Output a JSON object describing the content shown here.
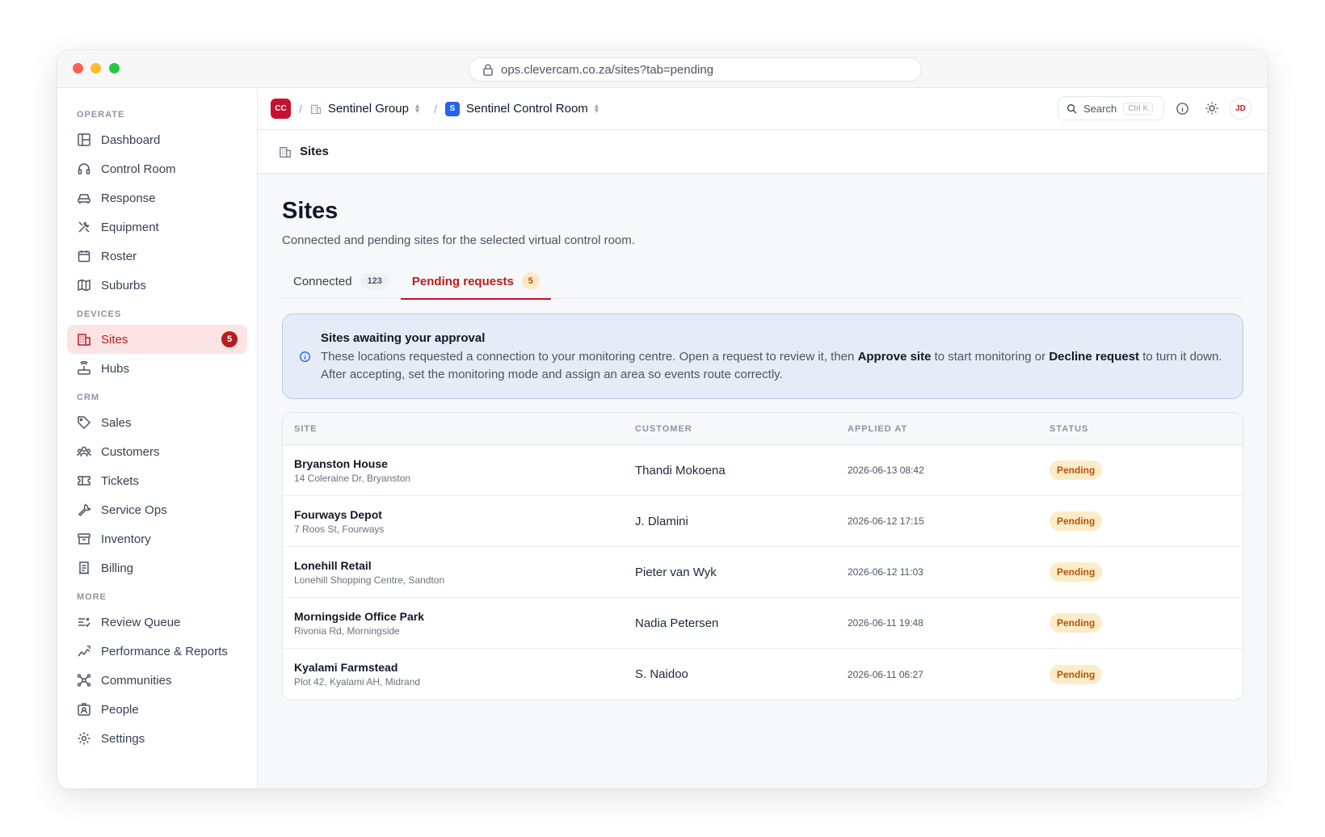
{
  "browser": {
    "url": "ops.clevercam.co.za/sites?tab=pending"
  },
  "topbar": {
    "org_initials": "CC",
    "separator": "/",
    "group_name": "Sentinel Group",
    "room_initial": "S",
    "room_name": "Sentinel Control Room",
    "search_label": "Search",
    "search_shortcut": "Ctrl K",
    "avatar_initials": "JD"
  },
  "sidebar": {
    "sections": [
      {
        "label": "OPERATE"
      },
      {
        "label": "DEVICES"
      },
      {
        "label": "CRM"
      },
      {
        "label": "MORE"
      }
    ],
    "items": [
      {
        "label": "Dashboard",
        "icon": "layout-icon"
      },
      {
        "label": "Control Room",
        "icon": "headset-icon"
      },
      {
        "label": "Response",
        "icon": "car-icon"
      },
      {
        "label": "Equipment",
        "icon": "tools-icon"
      },
      {
        "label": "Roster",
        "icon": "calendar-icon"
      },
      {
        "label": "Suburbs",
        "icon": "map-icon"
      },
      {
        "label": "Sites",
        "icon": "building-icon",
        "badge": "5"
      },
      {
        "label": "Hubs",
        "icon": "router-icon"
      },
      {
        "label": "Sales",
        "icon": "tag-icon"
      },
      {
        "label": "Customers",
        "icon": "users-icon"
      },
      {
        "label": "Tickets",
        "icon": "ticket-icon"
      },
      {
        "label": "Service Ops",
        "icon": "wrench-icon"
      },
      {
        "label": "Inventory",
        "icon": "archive-icon"
      },
      {
        "label": "Billing",
        "icon": "receipt-icon"
      },
      {
        "label": "Review Queue",
        "icon": "list-check-icon"
      },
      {
        "label": "Performance & Reports",
        "icon": "trend-icon"
      },
      {
        "label": "Communities",
        "icon": "network-icon"
      },
      {
        "label": "People",
        "icon": "id-badge-icon"
      },
      {
        "label": "Settings",
        "icon": "gear-icon"
      }
    ]
  },
  "subheader": {
    "title": "Sites"
  },
  "page": {
    "title": "Sites",
    "subtitle": "Connected and pending sites for the selected virtual control room."
  },
  "tabs": [
    {
      "label": "Connected",
      "count": "123"
    },
    {
      "label": "Pending requests",
      "count": "5"
    }
  ],
  "alert": {
    "title": "Sites awaiting your approval",
    "body_1": "These locations requested a connection to your monitoring centre. Open a request to review it, then ",
    "approve": "Approve site",
    "body_2": " to start monitoring or ",
    "decline": "Decline request",
    "body_3": " to turn it down. After accepting, set the monitoring mode and assign an area so events route correctly."
  },
  "table": {
    "columns": [
      "SITE",
      "CUSTOMER",
      "APPLIED AT",
      "STATUS"
    ],
    "rows": [
      {
        "site": "Bryanston House",
        "address": "14 Coleraine Dr, Bryanston",
        "customer": "Thandi Mokoena",
        "applied": "2026-06-13 08:42",
        "status": "Pending"
      },
      {
        "site": "Fourways Depot",
        "address": "7 Roos St, Fourways",
        "customer": "J. Dlamini",
        "applied": "2026-06-12 17:15",
        "status": "Pending"
      },
      {
        "site": "Lonehill Retail",
        "address": "Lonehill Shopping Centre, Sandton",
        "customer": "Pieter van Wyk",
        "applied": "2026-06-12 11:03",
        "status": "Pending"
      },
      {
        "site": "Morningside Office Park",
        "address": "Rivonia Rd, Morningside",
        "customer": "Nadia Petersen",
        "applied": "2026-06-11 19:48",
        "status": "Pending"
      },
      {
        "site": "Kyalami Farmstead",
        "address": "Plot 42, Kyalami AH, Midrand",
        "customer": "S. Naidoo",
        "applied": "2026-06-11 06:27",
        "status": "Pending"
      }
    ]
  },
  "colors": {
    "brand_red": "#c8102e",
    "active_bg": "#fde4e4",
    "pending_bg": "#fdecc8",
    "pending_text": "#b45309",
    "info_bg": "#e6ecf7",
    "room_blue": "#2563eb"
  }
}
